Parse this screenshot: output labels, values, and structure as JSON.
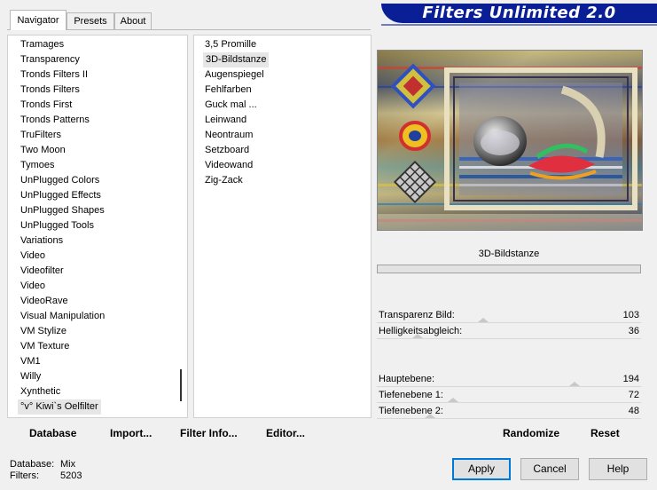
{
  "tabs": [
    {
      "label": "Navigator",
      "active": true
    },
    {
      "label": "Presets",
      "active": false
    },
    {
      "label": "About",
      "active": false
    }
  ],
  "banner": {
    "title": "Filters Unlimited 2.0",
    "color": "#0a1f95"
  },
  "categories": {
    "items": [
      "Tramages",
      "Transparency",
      "Tronds Filters II",
      "Tronds Filters",
      "Tronds First",
      "Tronds Patterns",
      "TruFilters",
      "Two Moon",
      "Tymoes",
      "UnPlugged Colors",
      "UnPlugged Effects",
      "UnPlugged Shapes",
      "UnPlugged Tools",
      "Variations",
      "Video",
      "Videofilter",
      "Video",
      "VideoRave",
      "Visual Manipulation",
      "VM Stylize",
      "VM Texture",
      "VM1",
      "Willy",
      "Xynthetic",
      "°v° Kiwi`s Oelfilter"
    ],
    "selected_index": 24
  },
  "filters": {
    "items": [
      "3,5 Promille",
      "3D-Bildstanze",
      "Augenspiegel",
      "Fehlfarben",
      "Guck mal ...",
      "Leinwand",
      "Neontraum",
      "Setzboard",
      "Videowand",
      "Zig-Zack"
    ],
    "selected_index": 1
  },
  "left_buttons": {
    "database": "Database",
    "import": "Import...",
    "filter_info": "Filter Info...",
    "editor": "Editor..."
  },
  "preview": {
    "filter_name": "3D-Bildstanze",
    "progress": 0
  },
  "params_group1": [
    {
      "label": "Transparenz Bild:",
      "value": "103",
      "level": 0.4
    },
    {
      "label": "Helligkeitsabgleich:",
      "value": "36",
      "level": 0.14
    }
  ],
  "params_group2": [
    {
      "label": "Hauptebene:",
      "value": "194",
      "level": 0.76
    },
    {
      "label": "Tiefenebene 1:",
      "value": "72",
      "level": 0.28
    },
    {
      "label": "Tiefenebene 2:",
      "value": "48",
      "level": 0.19
    }
  ],
  "right_buttons": {
    "randomize": "Randomize",
    "reset": "Reset"
  },
  "status": {
    "database_label": "Database:",
    "database_value": "Mix",
    "filters_label": "Filters:",
    "filters_value": "5203"
  },
  "dialog_buttons": {
    "apply": "Apply",
    "cancel": "Cancel",
    "help": "Help"
  }
}
